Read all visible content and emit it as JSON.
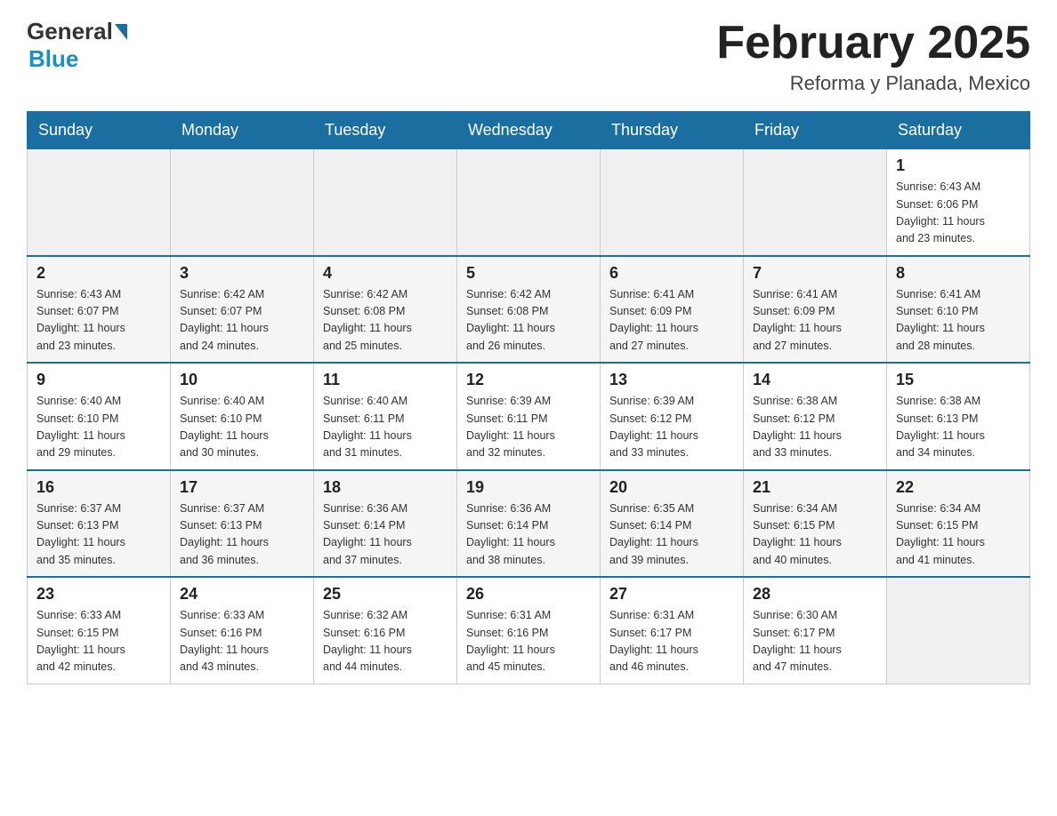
{
  "logo": {
    "general": "General",
    "blue": "Blue"
  },
  "title": "February 2025",
  "location": "Reforma y Planada, Mexico",
  "days_of_week": [
    "Sunday",
    "Monday",
    "Tuesday",
    "Wednesday",
    "Thursday",
    "Friday",
    "Saturday"
  ],
  "weeks": [
    [
      {
        "day": "",
        "info": ""
      },
      {
        "day": "",
        "info": ""
      },
      {
        "day": "",
        "info": ""
      },
      {
        "day": "",
        "info": ""
      },
      {
        "day": "",
        "info": ""
      },
      {
        "day": "",
        "info": ""
      },
      {
        "day": "1",
        "info": "Sunrise: 6:43 AM\nSunset: 6:06 PM\nDaylight: 11 hours\nand 23 minutes."
      }
    ],
    [
      {
        "day": "2",
        "info": "Sunrise: 6:43 AM\nSunset: 6:07 PM\nDaylight: 11 hours\nand 23 minutes."
      },
      {
        "day": "3",
        "info": "Sunrise: 6:42 AM\nSunset: 6:07 PM\nDaylight: 11 hours\nand 24 minutes."
      },
      {
        "day": "4",
        "info": "Sunrise: 6:42 AM\nSunset: 6:08 PM\nDaylight: 11 hours\nand 25 minutes."
      },
      {
        "day": "5",
        "info": "Sunrise: 6:42 AM\nSunset: 6:08 PM\nDaylight: 11 hours\nand 26 minutes."
      },
      {
        "day": "6",
        "info": "Sunrise: 6:41 AM\nSunset: 6:09 PM\nDaylight: 11 hours\nand 27 minutes."
      },
      {
        "day": "7",
        "info": "Sunrise: 6:41 AM\nSunset: 6:09 PM\nDaylight: 11 hours\nand 27 minutes."
      },
      {
        "day": "8",
        "info": "Sunrise: 6:41 AM\nSunset: 6:10 PM\nDaylight: 11 hours\nand 28 minutes."
      }
    ],
    [
      {
        "day": "9",
        "info": "Sunrise: 6:40 AM\nSunset: 6:10 PM\nDaylight: 11 hours\nand 29 minutes."
      },
      {
        "day": "10",
        "info": "Sunrise: 6:40 AM\nSunset: 6:10 PM\nDaylight: 11 hours\nand 30 minutes."
      },
      {
        "day": "11",
        "info": "Sunrise: 6:40 AM\nSunset: 6:11 PM\nDaylight: 11 hours\nand 31 minutes."
      },
      {
        "day": "12",
        "info": "Sunrise: 6:39 AM\nSunset: 6:11 PM\nDaylight: 11 hours\nand 32 minutes."
      },
      {
        "day": "13",
        "info": "Sunrise: 6:39 AM\nSunset: 6:12 PM\nDaylight: 11 hours\nand 33 minutes."
      },
      {
        "day": "14",
        "info": "Sunrise: 6:38 AM\nSunset: 6:12 PM\nDaylight: 11 hours\nand 33 minutes."
      },
      {
        "day": "15",
        "info": "Sunrise: 6:38 AM\nSunset: 6:13 PM\nDaylight: 11 hours\nand 34 minutes."
      }
    ],
    [
      {
        "day": "16",
        "info": "Sunrise: 6:37 AM\nSunset: 6:13 PM\nDaylight: 11 hours\nand 35 minutes."
      },
      {
        "day": "17",
        "info": "Sunrise: 6:37 AM\nSunset: 6:13 PM\nDaylight: 11 hours\nand 36 minutes."
      },
      {
        "day": "18",
        "info": "Sunrise: 6:36 AM\nSunset: 6:14 PM\nDaylight: 11 hours\nand 37 minutes."
      },
      {
        "day": "19",
        "info": "Sunrise: 6:36 AM\nSunset: 6:14 PM\nDaylight: 11 hours\nand 38 minutes."
      },
      {
        "day": "20",
        "info": "Sunrise: 6:35 AM\nSunset: 6:14 PM\nDaylight: 11 hours\nand 39 minutes."
      },
      {
        "day": "21",
        "info": "Sunrise: 6:34 AM\nSunset: 6:15 PM\nDaylight: 11 hours\nand 40 minutes."
      },
      {
        "day": "22",
        "info": "Sunrise: 6:34 AM\nSunset: 6:15 PM\nDaylight: 11 hours\nand 41 minutes."
      }
    ],
    [
      {
        "day": "23",
        "info": "Sunrise: 6:33 AM\nSunset: 6:15 PM\nDaylight: 11 hours\nand 42 minutes."
      },
      {
        "day": "24",
        "info": "Sunrise: 6:33 AM\nSunset: 6:16 PM\nDaylight: 11 hours\nand 43 minutes."
      },
      {
        "day": "25",
        "info": "Sunrise: 6:32 AM\nSunset: 6:16 PM\nDaylight: 11 hours\nand 44 minutes."
      },
      {
        "day": "26",
        "info": "Sunrise: 6:31 AM\nSunset: 6:16 PM\nDaylight: 11 hours\nand 45 minutes."
      },
      {
        "day": "27",
        "info": "Sunrise: 6:31 AM\nSunset: 6:17 PM\nDaylight: 11 hours\nand 46 minutes."
      },
      {
        "day": "28",
        "info": "Sunrise: 6:30 AM\nSunset: 6:17 PM\nDaylight: 11 hours\nand 47 minutes."
      },
      {
        "day": "",
        "info": ""
      }
    ]
  ]
}
